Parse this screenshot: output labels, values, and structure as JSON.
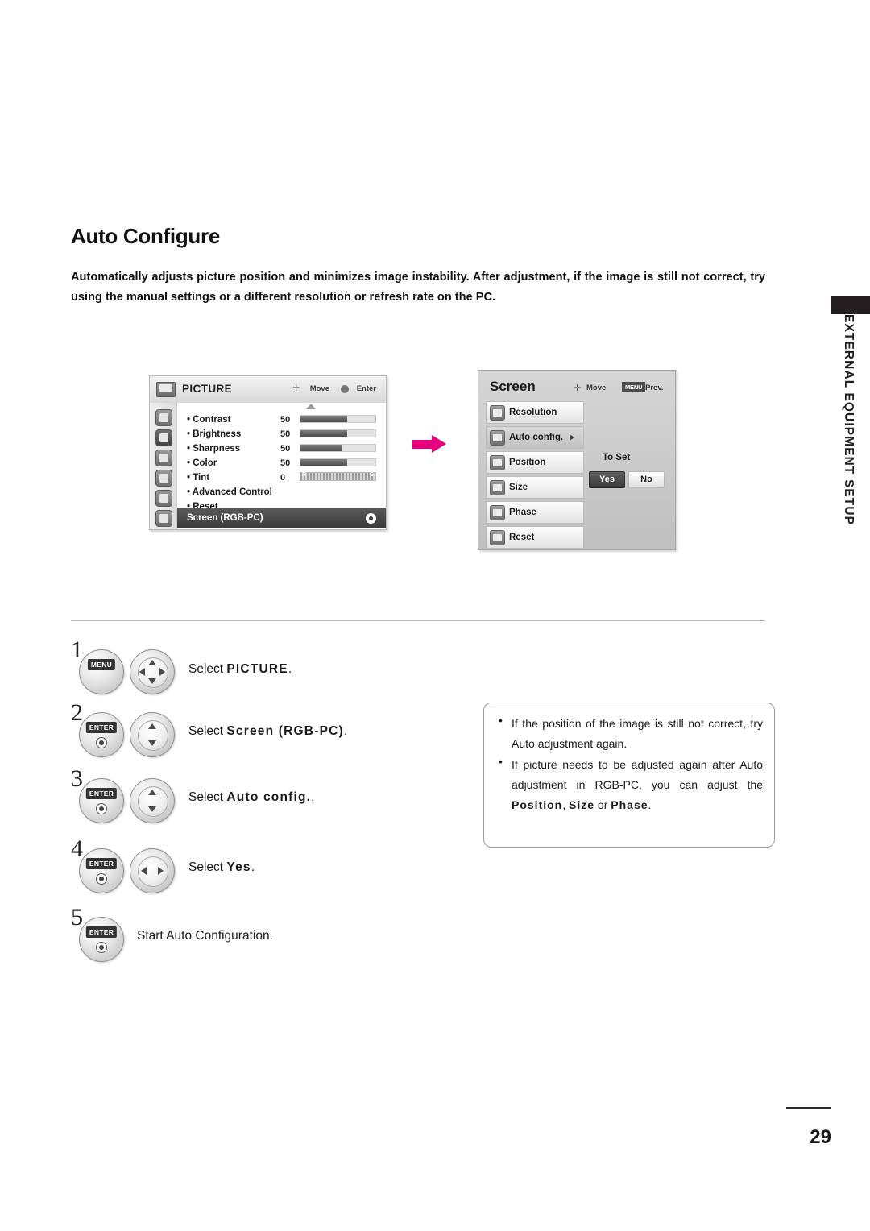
{
  "page": {
    "title": "Auto Configure",
    "intro": "Automatically adjusts picture position and minimizes image instability. After adjustment, if the image is still not correct, try using the manual settings or a different resolution or refresh rate on the PC.",
    "side_tab": "EXTERNAL EQUIPMENT SETUP",
    "number": "29"
  },
  "osd_picture": {
    "title": "PICTURE",
    "move_label": "Move",
    "enter_label": "Enter",
    "items": [
      {
        "label": "• Contrast",
        "value": "50",
        "fill": 62
      },
      {
        "label": "• Brightness",
        "value": "50",
        "fill": 62
      },
      {
        "label": "• Sharpness",
        "value": "50",
        "fill": 55
      },
      {
        "label": "• Color",
        "value": "50",
        "fill": 62
      },
      {
        "label": "• Tint",
        "value": "0",
        "fill": 50
      },
      {
        "label": "• Advanced Control",
        "value": "",
        "fill": 0
      },
      {
        "label": "• Reset",
        "value": "",
        "fill": 0
      }
    ],
    "tint_left": "R",
    "tint_right": "G",
    "footer_label": "Screen (RGB-PC)"
  },
  "osd_screen": {
    "title": "Screen",
    "move_label": "Move",
    "menu_chip": "MENU",
    "prev_label": "Prev.",
    "items": [
      {
        "label": "Resolution",
        "arrow": false
      },
      {
        "label": "Auto config.",
        "arrow": true
      },
      {
        "label": "Position",
        "arrow": false
      },
      {
        "label": "Size",
        "arrow": false
      },
      {
        "label": "Phase",
        "arrow": false
      },
      {
        "label": "Reset",
        "arrow": false
      }
    ],
    "to_set": "To Set",
    "yes_label": "Yes",
    "no_label": "No"
  },
  "steps": [
    {
      "num": "1",
      "button": "MENU",
      "text_prefix": "Select ",
      "text_bold": "PICTURE",
      "text_suffix": "."
    },
    {
      "num": "2",
      "button": "ENTER",
      "text_prefix": "Select ",
      "text_bold": "Screen (RGB-PC)",
      "text_suffix": "."
    },
    {
      "num": "3",
      "button": "ENTER",
      "text_prefix": "Select ",
      "text_bold": "Auto config.",
      "text_suffix": "."
    },
    {
      "num": "4",
      "button": "ENTER",
      "text_prefix": "Select ",
      "text_bold": "Yes",
      "text_suffix": "."
    },
    {
      "num": "5",
      "button": "ENTER",
      "text_prefix": "Start Auto Configuration.",
      "text_bold": "",
      "text_suffix": ""
    }
  ],
  "note": {
    "bullet": "•",
    "item1": "If the position of the image is still not correct, try Auto adjustment again.",
    "item2_a": "If picture needs to be adjusted again after Auto adjustment in RGB-PC, you can adjust the ",
    "item2_b": "Position",
    "item2_c": ", ",
    "item2_d": "Size",
    "item2_e": " or ",
    "item2_f": "Phase",
    "item2_g": "."
  }
}
